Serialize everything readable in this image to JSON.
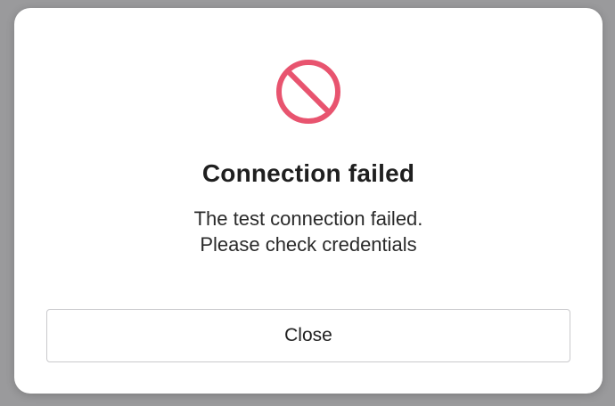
{
  "dialog": {
    "title": "Connection failed",
    "message_line1": "The test connection failed.",
    "message_line2": "Please check credentials",
    "close_label": "Close",
    "icon": "prohibited-icon"
  },
  "colors": {
    "error_accent": "#e8546f",
    "backdrop": "#9a9a9c",
    "surface": "#ffffff",
    "text": "#1f1f1f",
    "button_border": "#c9c9cc"
  }
}
